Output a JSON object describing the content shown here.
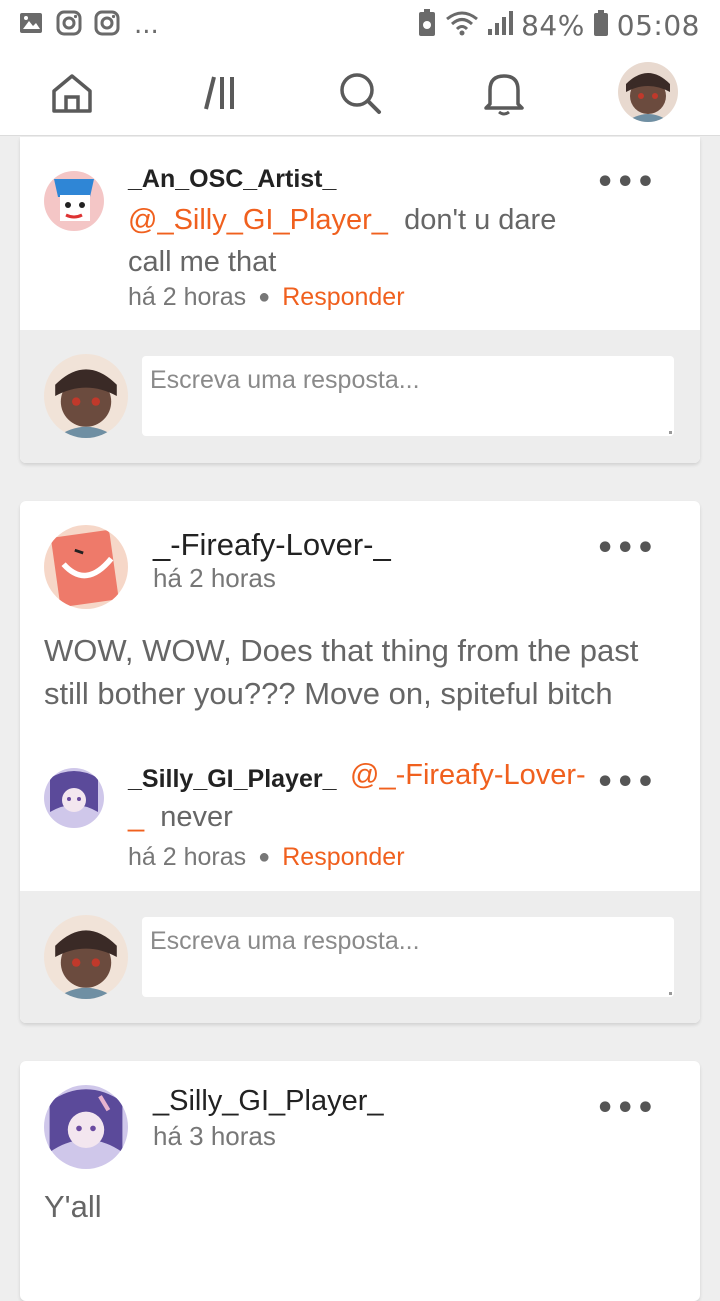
{
  "status_bar": {
    "battery": "84%",
    "time": "05:08",
    "dots": "..."
  },
  "nav": {
    "items": [
      "home-icon",
      "feed-icon",
      "search-icon",
      "bell-icon"
    ]
  },
  "reply_placeholder": "Escreva uma resposta...",
  "comments": [
    {
      "author": "_An_OSC_Artist_",
      "mention": "@_Silly_GI_Player_",
      "text_line1": "don't u dare",
      "text_line2": "call me that",
      "time": "há 2 horas",
      "reply_label": "Responder"
    },
    {
      "author": "_-Fireafy-Lover-_",
      "time": "há 2 horas",
      "body_line1": "WOW, WOW, Does that thing from the past",
      "body_line2": "still bother you??? Move on, spiteful bitch",
      "reply": {
        "author": "_Silly_GI_Player_",
        "mention_line1": "@_-Fireafy-Lover-",
        "mention_line2": "_",
        "text": "never",
        "time": "há 2 horas",
        "reply_label": "Responder"
      }
    },
    {
      "author": "_Silly_GI_Player_",
      "time": "há 3 horas",
      "body": "Y'all"
    }
  ]
}
